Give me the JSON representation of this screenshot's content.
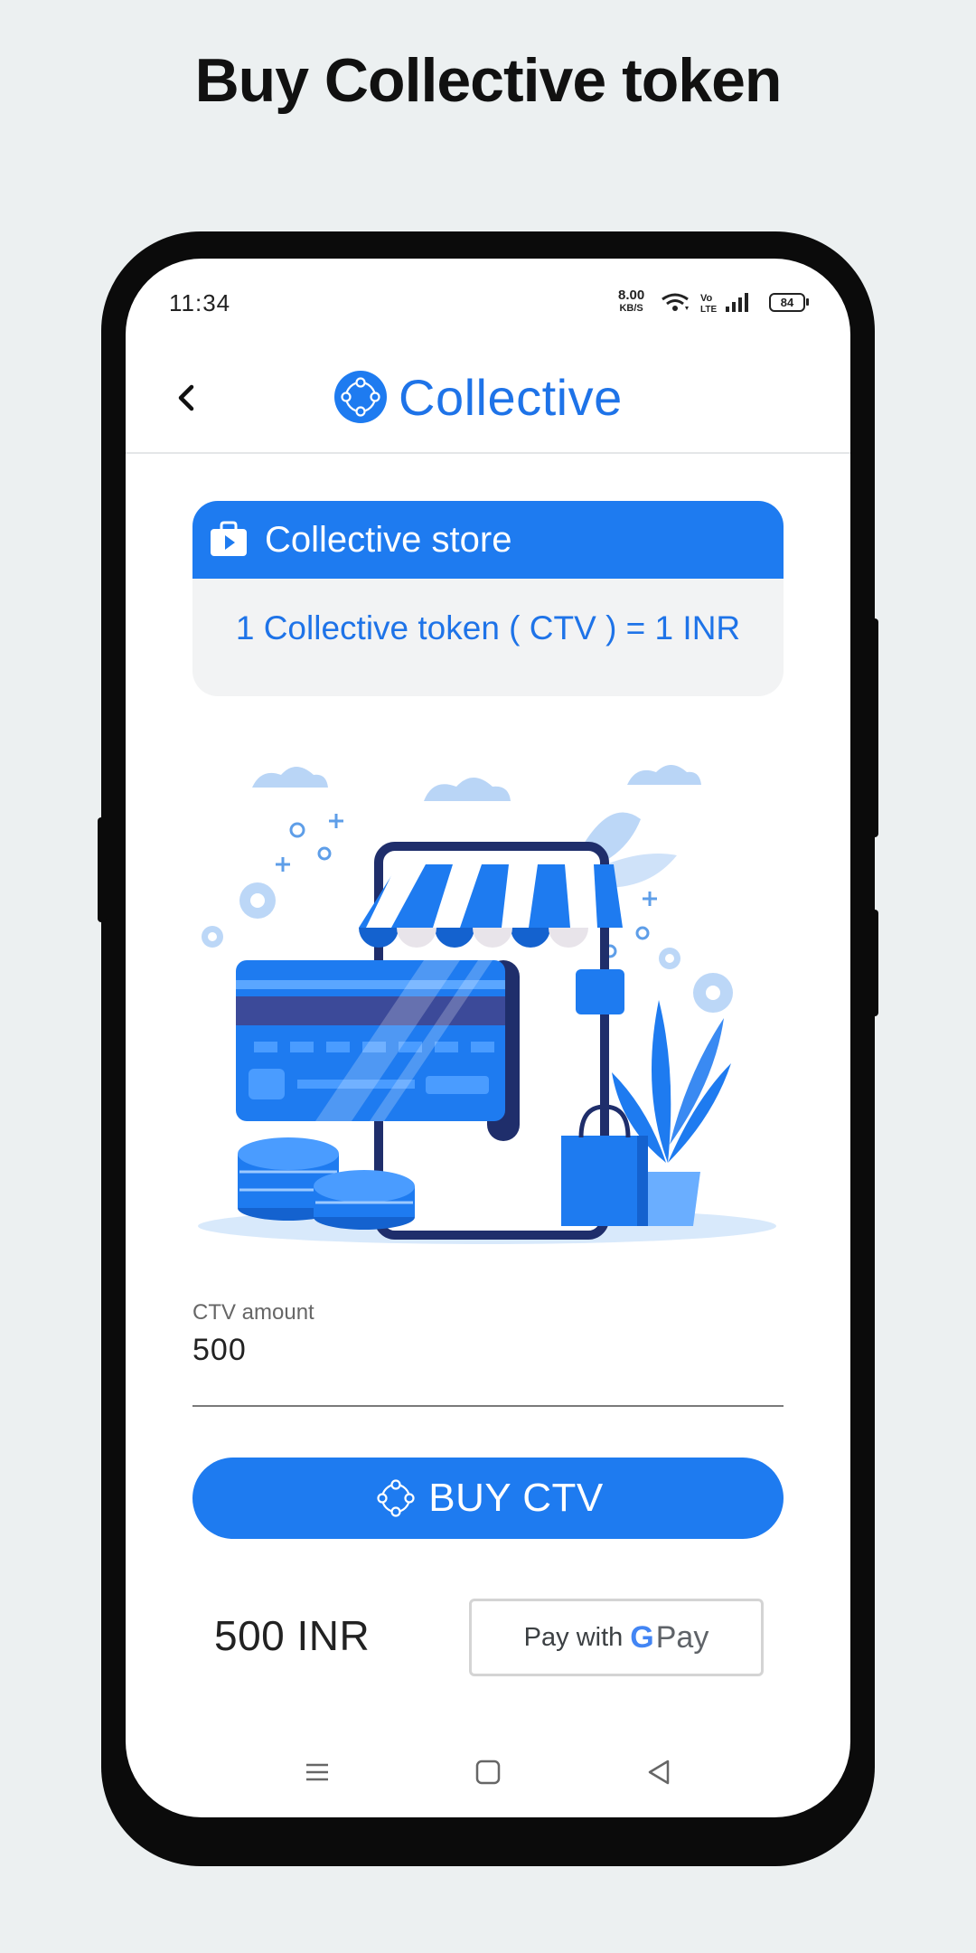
{
  "promo": {
    "title": "Buy Collective token"
  },
  "status_bar": {
    "time": "11:34",
    "net_speed": "8.00",
    "net_unit": "KB/S",
    "volte": "Vo LTE",
    "battery": "84",
    "icons": [
      "wifi-icon",
      "volte-icon",
      "signal-icon",
      "battery-icon"
    ]
  },
  "app_bar": {
    "back_icon": "chevron-left-icon",
    "brand_name": "Collective",
    "brand_logo": "collective-logo"
  },
  "store_card": {
    "title": "Collective store",
    "icon": "store-bag-icon",
    "rate": "1 Collective token ( CTV ) = 1 INR"
  },
  "illustration": {
    "subject": "online-store-illustration"
  },
  "amount_field": {
    "label": "CTV amount",
    "value": "500"
  },
  "buy_button": {
    "label": "BUY CTV",
    "icon": "collective-logo"
  },
  "payment": {
    "price": "500 INR",
    "gpay_prefix": "Pay with",
    "gpay_g": "G",
    "gpay_suffix": "Pay"
  },
  "nav_bar": {
    "items": [
      "menu-icon",
      "home-icon",
      "back-icon"
    ]
  },
  "colors": {
    "primary": "#1e7bf0",
    "brand_text": "#1e73e8",
    "background": "#ecf0f1",
    "card_bg": "#f2f3f4"
  }
}
